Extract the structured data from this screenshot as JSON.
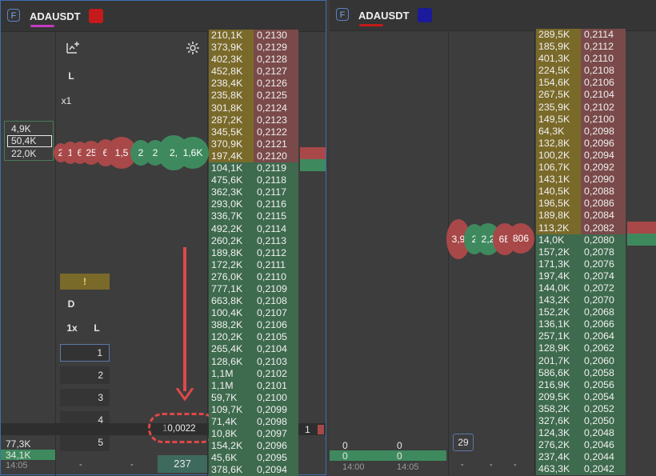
{
  "colors": {
    "ask_bg": "#7a4a4a",
    "bid_bg": "#3e6a4e",
    "vol_bg": "#7a6a2a",
    "accent_red": "#d13a3a",
    "accent_blue": "#1a1a9a",
    "panel_border": "#3f6fb0"
  },
  "panel1": {
    "logo": "F",
    "symbol": "ADAUSDT",
    "symbol_color": "#c41a1a",
    "controls": {
      "L": "L",
      "multiplier": "x1",
      "warning": "!",
      "D": "D",
      "size_1x": "1x",
      "L2": "L"
    },
    "size_buttons": [
      "1",
      "2",
      "3",
      "4",
      "5"
    ],
    "left_volumes": {
      "v1": "4,9K",
      "v2": "50,4K",
      "v3": "22,0K"
    },
    "bubbles": [
      "2",
      "1",
      "6",
      "25",
      "6",
      "1,5",
      "2",
      "2",
      "2,",
      "1,6K"
    ],
    "bottom_left": {
      "v1": "77,3K",
      "v2": "34,1K",
      "time": "14:05",
      "dash1": "-",
      "dash2": "-",
      "count": "237"
    },
    "spread_value": "0,0022",
    "spread_prefix": "1",
    "right_col": {
      "v1": "1"
    },
    "ladder": [
      [
        "210,1K",
        "0,2130",
        "ask"
      ],
      [
        "373,9K",
        "0,2129",
        "ask"
      ],
      [
        "402,3K",
        "0,2128",
        "ask"
      ],
      [
        "452,8K",
        "0,2127",
        "ask"
      ],
      [
        "238,4K",
        "0,2126",
        "ask"
      ],
      [
        "235,8K",
        "0,2125",
        "ask"
      ],
      [
        "301,8K",
        "0,2124",
        "ask"
      ],
      [
        "287,2K",
        "0,2123",
        "ask"
      ],
      [
        "345,5K",
        "0,2122",
        "ask"
      ],
      [
        "370,9K",
        "0,2121",
        "ask"
      ],
      [
        "197,4K",
        "0,2120",
        "ask"
      ],
      [
        "104,1K",
        "0,2119",
        "bid"
      ],
      [
        "475,6K",
        "0,2118",
        "bid"
      ],
      [
        "362,3K",
        "0,2117",
        "bid"
      ],
      [
        "293,0K",
        "0,2116",
        "bid"
      ],
      [
        "336,7K",
        "0,2115",
        "bid"
      ],
      [
        "492,2K",
        "0,2114",
        "bid"
      ],
      [
        "260,2K",
        "0,2113",
        "bid"
      ],
      [
        "189,8K",
        "0,2112",
        "bid"
      ],
      [
        "172,2K",
        "0,2111",
        "bid"
      ],
      [
        "276,0K",
        "0,2110",
        "bid"
      ],
      [
        "777,1K",
        "0,2109",
        "bid"
      ],
      [
        "663,8K",
        "0,2108",
        "bid"
      ],
      [
        "100,4K",
        "0,2107",
        "bid"
      ],
      [
        "388,2K",
        "0,2106",
        "bid"
      ],
      [
        "120,2K",
        "0,2105",
        "bid"
      ],
      [
        "265,4K",
        "0,2104",
        "bid"
      ],
      [
        "128,6K",
        "0,2103",
        "bid"
      ],
      [
        "1,1M",
        "0,2102",
        "bid"
      ],
      [
        "1,1M",
        "0,2101",
        "bid"
      ],
      [
        "59,7K",
        "0,2100",
        "bid"
      ],
      [
        "109,7K",
        "0,2099",
        "bid"
      ],
      [
        "71,4K",
        "0,2098",
        "bid"
      ],
      [
        "10,8K",
        "0,2097",
        "bid"
      ],
      [
        "154,2K",
        "0,2096",
        "bid"
      ],
      [
        "45,6K",
        "0,2095",
        "bid"
      ],
      [
        "378,6K",
        "0,2094",
        "bid"
      ]
    ]
  },
  "panel2": {
    "logo": "F",
    "symbol": "ADAUSDT",
    "symbol_color": "#1a1a9a",
    "bubbles": [
      "3,9",
      "2",
      "2,2",
      "6E",
      "806"
    ],
    "bottom": {
      "z1": "0",
      "z2": "0",
      "z3": "0",
      "z4": "0",
      "t1": "14:00",
      "t2": "14:05",
      "badge": "29",
      "d1": "-",
      "d2": "-",
      "d3": "-"
    },
    "ladder": [
      [
        "289,5K",
        "0,2114",
        "ask"
      ],
      [
        "185,9K",
        "0,2112",
        "ask"
      ],
      [
        "401,3K",
        "0,2110",
        "ask"
      ],
      [
        "224,5K",
        "0,2108",
        "ask"
      ],
      [
        "154,6K",
        "0,2106",
        "ask"
      ],
      [
        "267,5K",
        "0,2104",
        "ask"
      ],
      [
        "235,9K",
        "0,2102",
        "ask"
      ],
      [
        "149,5K",
        "0,2100",
        "ask"
      ],
      [
        "64,3K",
        "0,2098",
        "ask"
      ],
      [
        "132,8K",
        "0,2096",
        "ask"
      ],
      [
        "100,2K",
        "0,2094",
        "ask"
      ],
      [
        "106,7K",
        "0,2092",
        "ask"
      ],
      [
        "143,1K",
        "0,2090",
        "ask"
      ],
      [
        "140,5K",
        "0,2088",
        "ask"
      ],
      [
        "196,5K",
        "0,2086",
        "ask"
      ],
      [
        "189,8K",
        "0,2084",
        "ask"
      ],
      [
        "113,2K",
        "0,2082",
        "ask"
      ],
      [
        "14,0K",
        "0,2080",
        "bid"
      ],
      [
        "157,2K",
        "0,2078",
        "bid"
      ],
      [
        "171,3K",
        "0,2076",
        "bid"
      ],
      [
        "197,4K",
        "0,2074",
        "bid"
      ],
      [
        "144,0K",
        "0,2072",
        "bid"
      ],
      [
        "143,2K",
        "0,2070",
        "bid"
      ],
      [
        "152,2K",
        "0,2068",
        "bid"
      ],
      [
        "136,1K",
        "0,2066",
        "bid"
      ],
      [
        "257,1K",
        "0,2064",
        "bid"
      ],
      [
        "128,9K",
        "0,2062",
        "bid"
      ],
      [
        "201,7K",
        "0,2060",
        "bid"
      ],
      [
        "586,6K",
        "0,2058",
        "bid"
      ],
      [
        "216,9K",
        "0,2056",
        "bid"
      ],
      [
        "209,5K",
        "0,2054",
        "bid"
      ],
      [
        "358,2K",
        "0,2052",
        "bid"
      ],
      [
        "327,6K",
        "0,2050",
        "bid"
      ],
      [
        "124,3K",
        "0,2048",
        "bid"
      ],
      [
        "276,2K",
        "0,2046",
        "bid"
      ],
      [
        "237,4K",
        "0,2044",
        "bid"
      ],
      [
        "463,3K",
        "0,2042",
        "bid"
      ]
    ]
  }
}
